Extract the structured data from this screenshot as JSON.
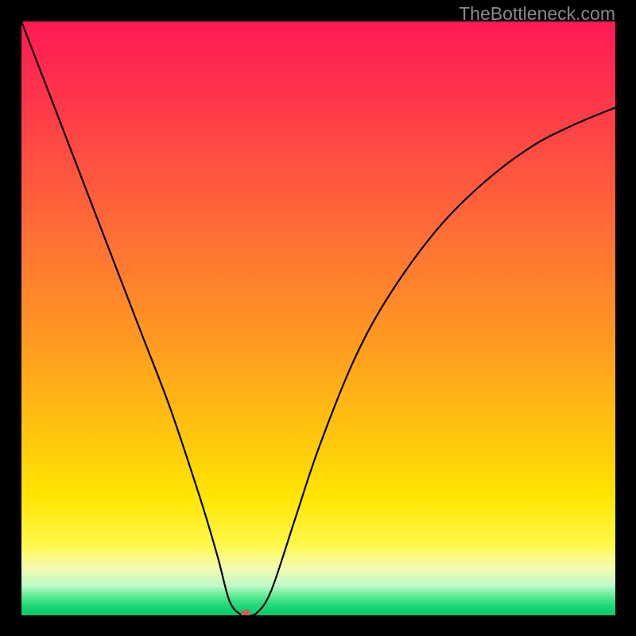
{
  "watermark": "TheBottleneck.com",
  "chart_data": {
    "type": "line",
    "title": "",
    "xlabel": "",
    "ylabel": "",
    "xlim": [
      0,
      1
    ],
    "ylim": [
      0,
      1
    ],
    "legend": false,
    "grid": false,
    "series": [
      {
        "name": "curve",
        "x": [
          0.0,
          0.05,
          0.1,
          0.15,
          0.2,
          0.25,
          0.3,
          0.33,
          0.35,
          0.368,
          0.38,
          0.395,
          0.42,
          0.46,
          0.5,
          0.56,
          0.62,
          0.7,
          0.78,
          0.86,
          0.93,
          1.0
        ],
        "y": [
          1.0,
          0.87,
          0.74,
          0.61,
          0.48,
          0.35,
          0.2,
          0.1,
          0.025,
          0.002,
          0.002,
          0.003,
          0.04,
          0.16,
          0.28,
          0.43,
          0.54,
          0.65,
          0.73,
          0.79,
          0.826,
          0.855
        ]
      }
    ],
    "marker": {
      "x": 0.378,
      "y": 0.002,
      "color": "#c9615e",
      "radius_px": 6
    },
    "gradient_top": "#ff1a55",
    "gradient_bottom": "#0dc869",
    "line_color": "#000000"
  }
}
